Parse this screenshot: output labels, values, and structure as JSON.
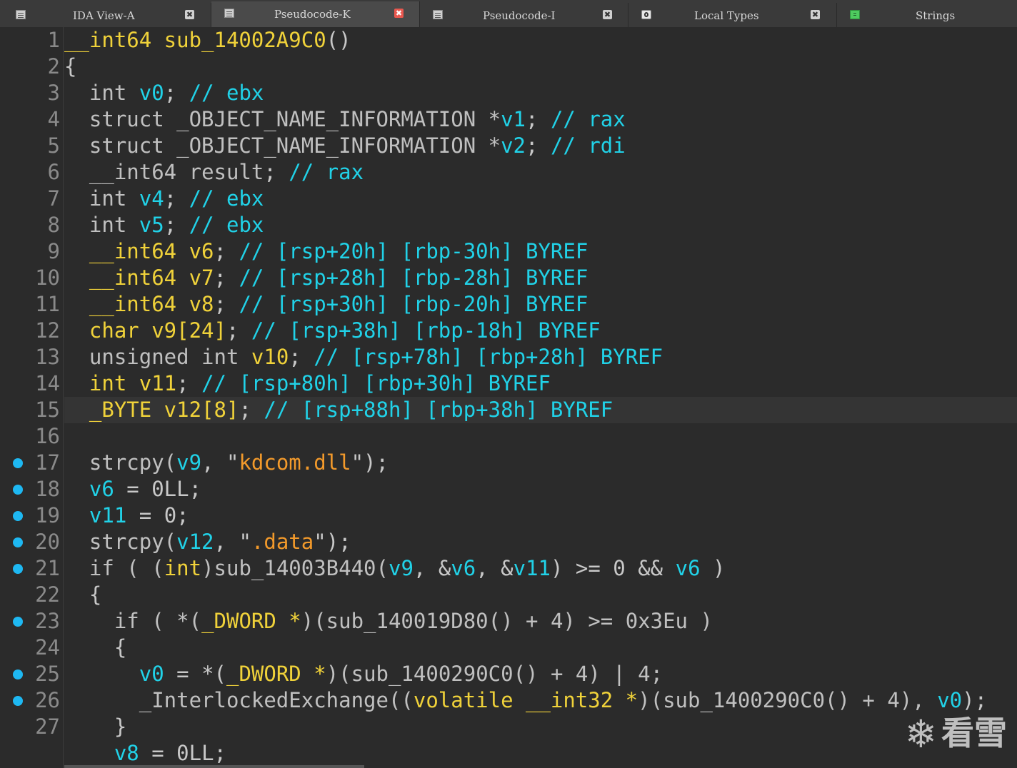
{
  "tabs": [
    {
      "label": "IDA View-A",
      "icon": "listing-icon",
      "active": false,
      "closable": true
    },
    {
      "label": "Pseudocode-K",
      "icon": "listing-icon",
      "active": true,
      "closable": true
    },
    {
      "label": "Pseudocode-I",
      "icon": "listing-icon",
      "active": false,
      "closable": true
    },
    {
      "label": "Local Types",
      "icon": "types-icon",
      "active": false,
      "closable": true
    },
    {
      "label": "Strings",
      "icon": "strings-icon",
      "active": false,
      "closable": false
    }
  ],
  "close_glyph": "✖",
  "watermark": {
    "text": "看雪",
    "icon": "snowflake-icon",
    "glyph": "❄"
  },
  "highlighted_line": 15,
  "colors": {
    "keyword": "#c0c0c0",
    "type": "#21d2e8",
    "variable": "#f0d23a",
    "string": "#f39a2b",
    "breakpoint_dot": "#1eb8f2"
  },
  "code": [
    {
      "num": "1",
      "dot": false,
      "tokens": [
        [
          "y",
          "__int64 sub_14002A9C0"
        ],
        [
          "p",
          "()"
        ]
      ]
    },
    {
      "num": "2",
      "dot": false,
      "tokens": [
        [
          "p",
          "{"
        ]
      ]
    },
    {
      "num": "3",
      "dot": false,
      "tokens": [
        [
          "k",
          "  int "
        ],
        [
          "t",
          "v0"
        ],
        [
          "p",
          "; "
        ],
        [
          "t",
          "// ebx"
        ]
      ]
    },
    {
      "num": "4",
      "dot": false,
      "tokens": [
        [
          "k",
          "  struct _OBJECT_NAME_INFORMATION *"
        ],
        [
          "t",
          "v1"
        ],
        [
          "p",
          "; "
        ],
        [
          "t",
          "// rax"
        ]
      ]
    },
    {
      "num": "5",
      "dot": false,
      "tokens": [
        [
          "k",
          "  struct _OBJECT_NAME_INFORMATION *"
        ],
        [
          "t",
          "v2"
        ],
        [
          "p",
          "; "
        ],
        [
          "t",
          "// rdi"
        ]
      ]
    },
    {
      "num": "6",
      "dot": false,
      "tokens": [
        [
          "k",
          "  __int64 "
        ],
        [
          "k",
          "result"
        ],
        [
          "p",
          "; "
        ],
        [
          "t",
          "// rax"
        ]
      ]
    },
    {
      "num": "7",
      "dot": false,
      "tokens": [
        [
          "k",
          "  int "
        ],
        [
          "t",
          "v4"
        ],
        [
          "p",
          "; "
        ],
        [
          "t",
          "// ebx"
        ]
      ]
    },
    {
      "num": "8",
      "dot": false,
      "tokens": [
        [
          "k",
          "  int "
        ],
        [
          "t",
          "v5"
        ],
        [
          "p",
          "; "
        ],
        [
          "t",
          "// ebx"
        ]
      ]
    },
    {
      "num": "9",
      "dot": false,
      "tokens": [
        [
          "y",
          "  __int64 v6"
        ],
        [
          "p",
          "; "
        ],
        [
          "t",
          "// [rsp+20h] [rbp-30h] BYREF"
        ]
      ]
    },
    {
      "num": "10",
      "dot": false,
      "tokens": [
        [
          "y",
          "  __int64 v7"
        ],
        [
          "p",
          "; "
        ],
        [
          "t",
          "// [rsp+28h] [rbp-28h] BYREF"
        ]
      ]
    },
    {
      "num": "11",
      "dot": false,
      "tokens": [
        [
          "y",
          "  __int64 v8"
        ],
        [
          "p",
          "; "
        ],
        [
          "t",
          "// [rsp+30h] [rbp-20h] BYREF"
        ]
      ]
    },
    {
      "num": "12",
      "dot": false,
      "tokens": [
        [
          "y",
          "  char v9[24]"
        ],
        [
          "p",
          "; "
        ],
        [
          "t",
          "// [rsp+38h] [rbp-18h] BYREF"
        ]
      ]
    },
    {
      "num": "13",
      "dot": false,
      "tokens": [
        [
          "k",
          "  unsigned int "
        ],
        [
          "y",
          "v10"
        ],
        [
          "p",
          "; "
        ],
        [
          "t",
          "// [rsp+78h] [rbp+28h] BYREF"
        ]
      ]
    },
    {
      "num": "14",
      "dot": false,
      "tokens": [
        [
          "y",
          "  int v11"
        ],
        [
          "p",
          "; "
        ],
        [
          "t",
          "// [rsp+80h] [rbp+30h] BYREF"
        ]
      ]
    },
    {
      "num": "15",
      "dot": false,
      "tokens": [
        [
          "y",
          "  _BYTE v12[8]"
        ],
        [
          "p",
          "; "
        ],
        [
          "t",
          "// [rsp+88h] [rbp+38h] BYREF"
        ]
      ]
    },
    {
      "num": "16",
      "dot": false,
      "tokens": []
    },
    {
      "num": "17",
      "dot": true,
      "tokens": [
        [
          "k",
          "  strcpy("
        ],
        [
          "t",
          "v9"
        ],
        [
          "p",
          ", \""
        ],
        [
          "s",
          "kdcom.dll"
        ],
        [
          "p",
          "\");"
        ]
      ]
    },
    {
      "num": "18",
      "dot": true,
      "tokens": [
        [
          "t",
          "  v6"
        ],
        [
          "p",
          " = 0LL;"
        ]
      ]
    },
    {
      "num": "19",
      "dot": true,
      "tokens": [
        [
          "t",
          "  v11"
        ],
        [
          "p",
          " = 0;"
        ]
      ]
    },
    {
      "num": "20",
      "dot": true,
      "tokens": [
        [
          "k",
          "  strcpy("
        ],
        [
          "t",
          "v12"
        ],
        [
          "p",
          ", \""
        ],
        [
          "s",
          ".data"
        ],
        [
          "p",
          "\");"
        ]
      ]
    },
    {
      "num": "21",
      "dot": true,
      "tokens": [
        [
          "k",
          "  if ( ("
        ],
        [
          "y",
          "int"
        ],
        [
          "k",
          ")sub_14003B440("
        ],
        [
          "t",
          "v9"
        ],
        [
          "p",
          ", &"
        ],
        [
          "t",
          "v6"
        ],
        [
          "p",
          ", &"
        ],
        [
          "t",
          "v11"
        ],
        [
          "p",
          ") >= 0 && "
        ],
        [
          "t",
          "v6"
        ],
        [
          "p",
          " )"
        ]
      ]
    },
    {
      "num": "22",
      "dot": false,
      "tokens": [
        [
          "p",
          "  {"
        ]
      ]
    },
    {
      "num": "23",
      "dot": true,
      "tokens": [
        [
          "k",
          "    if ( *("
        ],
        [
          "y",
          "_DWORD *"
        ],
        [
          "k",
          ")(sub_140019D80() + 4) >= 0x3Eu )"
        ]
      ]
    },
    {
      "num": "24",
      "dot": false,
      "tokens": [
        [
          "p",
          "    {"
        ]
      ]
    },
    {
      "num": "25",
      "dot": true,
      "tokens": [
        [
          "t",
          "      v0"
        ],
        [
          "p",
          " = *("
        ],
        [
          "y",
          "_DWORD *"
        ],
        [
          "k",
          ")(sub_1400290C0() + 4) | 4;"
        ]
      ]
    },
    {
      "num": "26",
      "dot": true,
      "tokens": [
        [
          "k",
          "      _InterlockedExchange(("
        ],
        [
          "y",
          "volatile __int32 *"
        ],
        [
          "k",
          ")(sub_1400290C0() + 4), "
        ],
        [
          "t",
          "v0"
        ],
        [
          "p",
          ");"
        ]
      ]
    },
    {
      "num": "27",
      "dot": false,
      "tokens": [
        [
          "p",
          "    }"
        ]
      ]
    },
    {
      "num": "",
      "dot": false,
      "tokens": [
        [
          "t",
          "    v8"
        ],
        [
          "p",
          " = 0LL;"
        ]
      ]
    }
  ]
}
